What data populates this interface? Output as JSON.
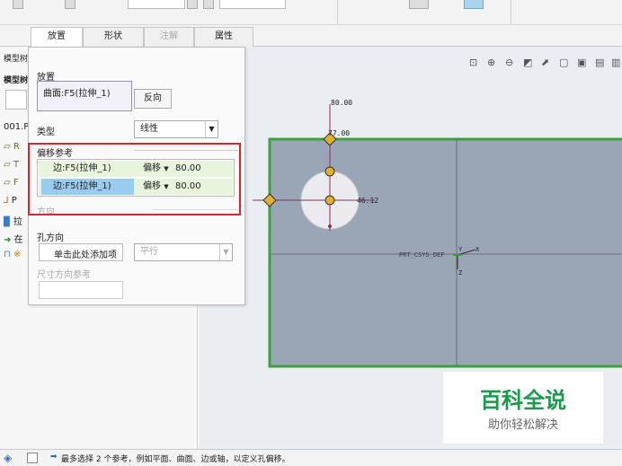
{
  "tabs": {
    "placement": "放置",
    "shape": "形状",
    "note": "注解",
    "properties": "属性"
  },
  "tree": {
    "header1": "模型树",
    "header2": "模型树",
    "items": [
      "001.P",
      "R",
      "T",
      "F",
      "P",
      "拉",
      "在",
      "※"
    ]
  },
  "panel": {
    "placement_label": "放置",
    "placement_ref": "曲面:F5(拉伸_1)",
    "flip_button": "反向",
    "type_label": "类型",
    "type_value": "线性",
    "offset_label": "偏移参考",
    "offset_rows": [
      {
        "ref": "边:F5(拉伸_1)",
        "mode": "偏移",
        "value": "80.00"
      },
      {
        "ref": "边:F5(拉伸_1)",
        "mode": "偏移",
        "value": "80.00"
      }
    ],
    "direction_label": "方向",
    "hole_dir_label": "孔方向",
    "hole_dir_button": "单击此处添加项",
    "hole_dir_select": "平行",
    "dim_dir_label": "尺寸方向参考"
  },
  "viewport": {
    "dim_top": "80.00",
    "dim_top2": "77.00",
    "dim_diameter": "46.12",
    "csys_label": "PRT_CSYS_DEF",
    "axis_y": "Y",
    "axis_x": "X",
    "axis_z": "Z"
  },
  "status": {
    "message": "最多选择 2 个参考，例如平面、曲面、边或轴，以定义孔偏移。"
  },
  "watermark": {
    "title": "百科全说",
    "subtitle": "助你轻松解决"
  },
  "colors": {
    "part_face": "#9aa6b5",
    "part_edge": "#3ca33c",
    "highlight_red": "#d9252b",
    "selected_row": "#99ccee",
    "row_green": "#e6f5dc"
  }
}
